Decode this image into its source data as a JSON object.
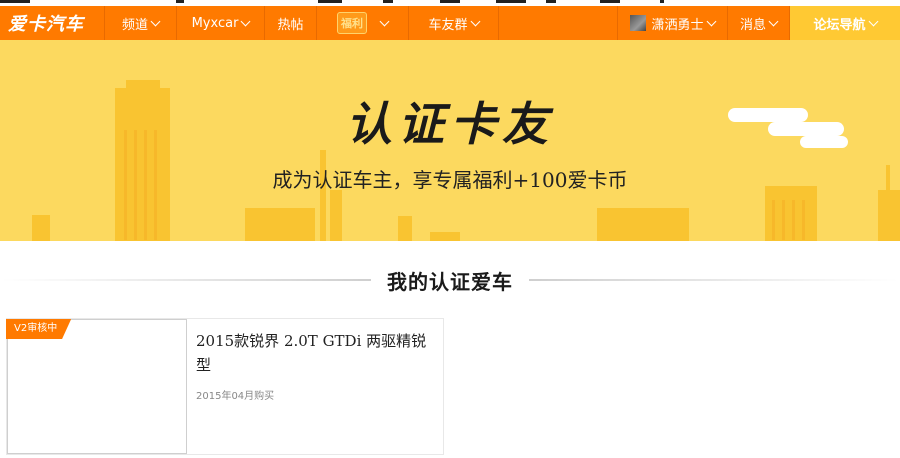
{
  "nav": {
    "logo": "爱卡汽车",
    "items": [
      {
        "label": "频道"
      },
      {
        "label": "Myxcar"
      },
      {
        "label": "热帖"
      },
      {
        "label": "福利"
      },
      {
        "label": "车友群"
      }
    ],
    "user": {
      "name": "潇洒勇士"
    },
    "messages": "消息",
    "forum_guide": "论坛导航"
  },
  "banner": {
    "title": "认证卡友",
    "subtitle": "成为认证车主，享专属福利+100爱卡币"
  },
  "section": {
    "title": "我的认证爱车"
  },
  "car": {
    "status": "V2审核中",
    "name": "2015款锐界 2.0T GTDi 两驱精锐型",
    "purchase_date": "2015年04月购买"
  },
  "colors": {
    "nav_bg": "#ff7a00",
    "guide_bg": "#ffc933",
    "banner_bg": "#fcd95f"
  }
}
